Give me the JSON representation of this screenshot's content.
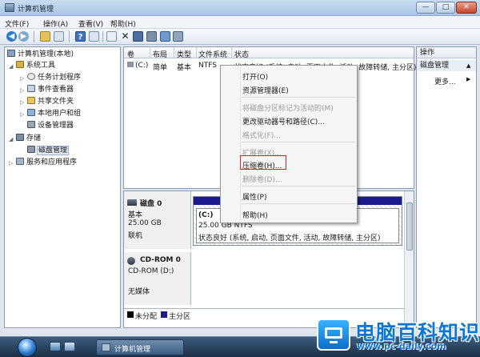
{
  "window": {
    "title": "计算机管理",
    "min_glyph": "—",
    "max_glyph": "□",
    "close_glyph": "✕"
  },
  "menu": [
    "文件(F)",
    "操作(A)",
    "查看(V)",
    "帮助(H)"
  ],
  "toolbar": {
    "delete_glyph": "✕"
  },
  "tree": {
    "root": "计算机管理(本地)",
    "system_tools": "系统工具",
    "task_scheduler": "任务计划程序",
    "event_viewer": "事件查看器",
    "shared_folders": "共享文件夹",
    "local_users": "本地用户和组",
    "device_manager": "设备管理器",
    "storage": "存储",
    "disk_management": "磁盘管理",
    "services": "服务和应用程序"
  },
  "volume_list": {
    "headers": [
      "卷",
      "布局",
      "类型",
      "文件系统",
      "状态"
    ],
    "row": {
      "volume": "(C:)",
      "layout": "简单",
      "type": "基本",
      "fs": "NTFS",
      "status": "状态良好 (系统, 启动, 页面文件, 活动, 故障转储, 主分区)"
    }
  },
  "disk0": {
    "name": "磁盘 0",
    "kind": "基本",
    "size": "25.00 GB",
    "state": "联机",
    "partition": {
      "label": "(C:)",
      "size_fs": "25.00 GB NTFS",
      "status": "状态良好 (系统, 启动, 页面文件, 活动, 故障转储, 主分区)"
    }
  },
  "cdrom0": {
    "name": "CD-ROM 0",
    "drive": "CD-ROM (D:)",
    "media": "无媒体"
  },
  "legend": {
    "unallocated": "未分配",
    "primary": "主分区"
  },
  "actions": {
    "header": "操作",
    "section": "磁盘管理",
    "more": "更多...",
    "section_arrow": "▲",
    "more_arrow": "▶"
  },
  "context_menu": {
    "open": "打开(O)",
    "explore": "资源管理器(E)",
    "mark_active": "将磁盘分区标记为活动的(M)",
    "change_letter": "更改驱动器号和路径(C)...",
    "format": "格式化(F)...",
    "extend": "扩展卷(X)...",
    "shrink": "压缩卷(H)...",
    "delete": "删除卷(D)...",
    "properties": "属性(P)",
    "help": "帮助(H)"
  },
  "taskbar": {
    "task_title": "计算机管理"
  },
  "watermark": {
    "name": "电脑百科知识",
    "url": "www.pc-daily.com"
  },
  "colors": {
    "primary_partition": "#1b1b8d",
    "highlight_box": "#d4242a",
    "watermark": "#0d76d2"
  }
}
